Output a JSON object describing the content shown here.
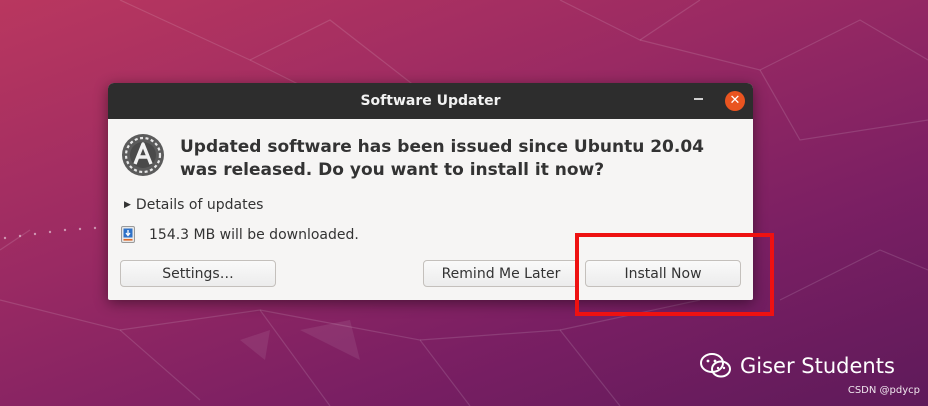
{
  "window": {
    "title": "Software Updater"
  },
  "message": {
    "headline": "Updated software has been issued since Ubuntu 20.04 was released. Do you want to install it now?"
  },
  "details": {
    "label": "Details of updates"
  },
  "download": {
    "text": "154.3 MB will be downloaded."
  },
  "buttons": {
    "settings": "Settings…",
    "remind": "Remind Me Later",
    "install": "Install Now"
  },
  "watermark": {
    "brand": "Giser Students",
    "credit": "CSDN @pdycp"
  },
  "icons": {
    "app": "software-updater-icon",
    "close": "close-icon",
    "minimize": "minimize-icon",
    "expander": "triangle-right-icon",
    "download": "download-icon",
    "wechat": "wechat-icon"
  },
  "colors": {
    "close_button": "#e95420",
    "highlight": "#ee1111",
    "titlebar": "#2d2d2d"
  }
}
